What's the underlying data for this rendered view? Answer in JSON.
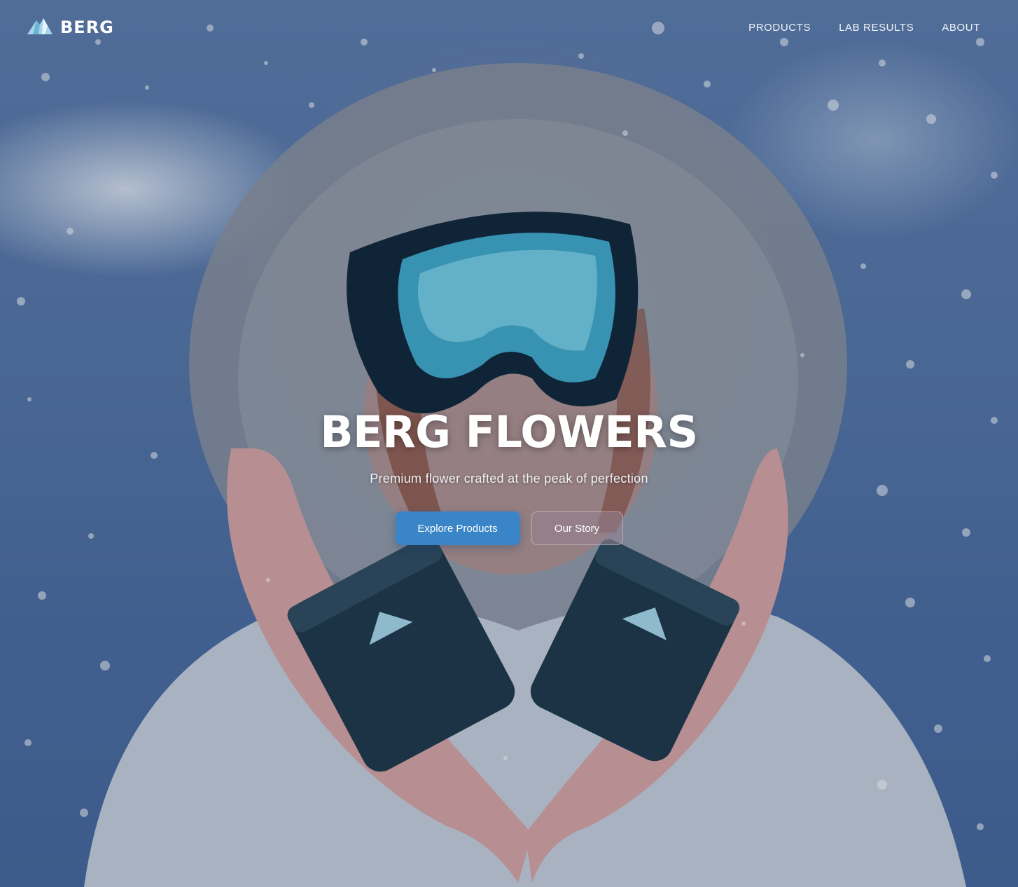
{
  "brand": {
    "name": "BERG",
    "logo_icon": "mountain-peak-icon"
  },
  "nav": {
    "items": [
      {
        "label": "PRODUCTS"
      },
      {
        "label": "LAB RESULTS"
      },
      {
        "label": "ABOUT"
      }
    ]
  },
  "hero": {
    "title": "BERG FLOWERS",
    "subtitle": "Premium flower crafted at the peak of perfection",
    "primary_button": "Explore Products",
    "secondary_button": "Our Story"
  },
  "colors": {
    "accent": "#3a84c8",
    "background": "#5675a4"
  }
}
